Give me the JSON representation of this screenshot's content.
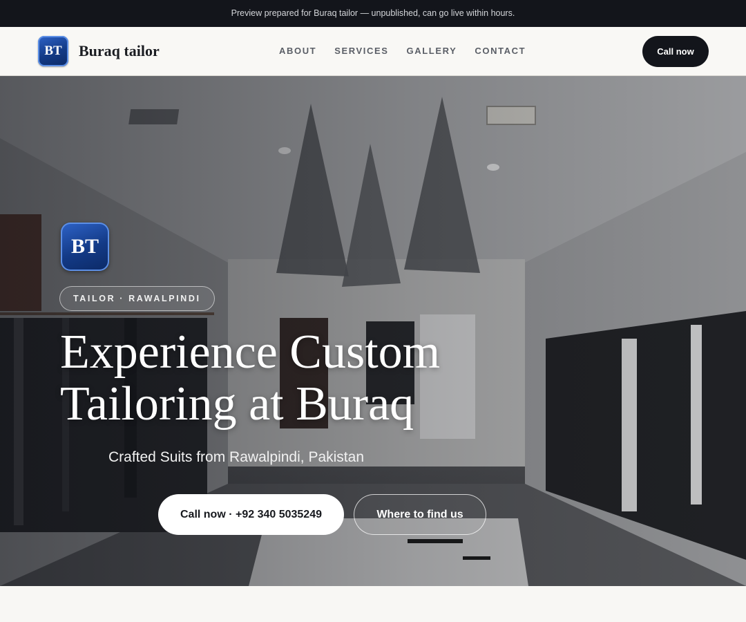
{
  "preview_banner": {
    "text": "Preview prepared for Buraq tailor — unpublished, can go live within hours."
  },
  "header": {
    "logo_initials": "BT",
    "brand_name": "Buraq tailor",
    "nav": [
      "ABOUT",
      "SERVICES",
      "GALLERY",
      "CONTACT"
    ],
    "call_button": "Call now"
  },
  "hero": {
    "logo_initials": "BT",
    "tag": "TAILOR · RAWALPINDI",
    "headline_line1": "Experience Custom",
    "headline_line2": "Tailoring at Buraq",
    "subheadline": "Crafted Suits from Rawalpindi, Pakistan",
    "primary_button": "Call now · +92 340 5035249",
    "secondary_button": "Where to find us",
    "background_image": "clothing-store-interior-photo"
  },
  "colors": {
    "dark": "#13151b",
    "page_background": "#f8f7f4",
    "logo_blue": "#1d4aa6",
    "white": "#ffffff"
  }
}
